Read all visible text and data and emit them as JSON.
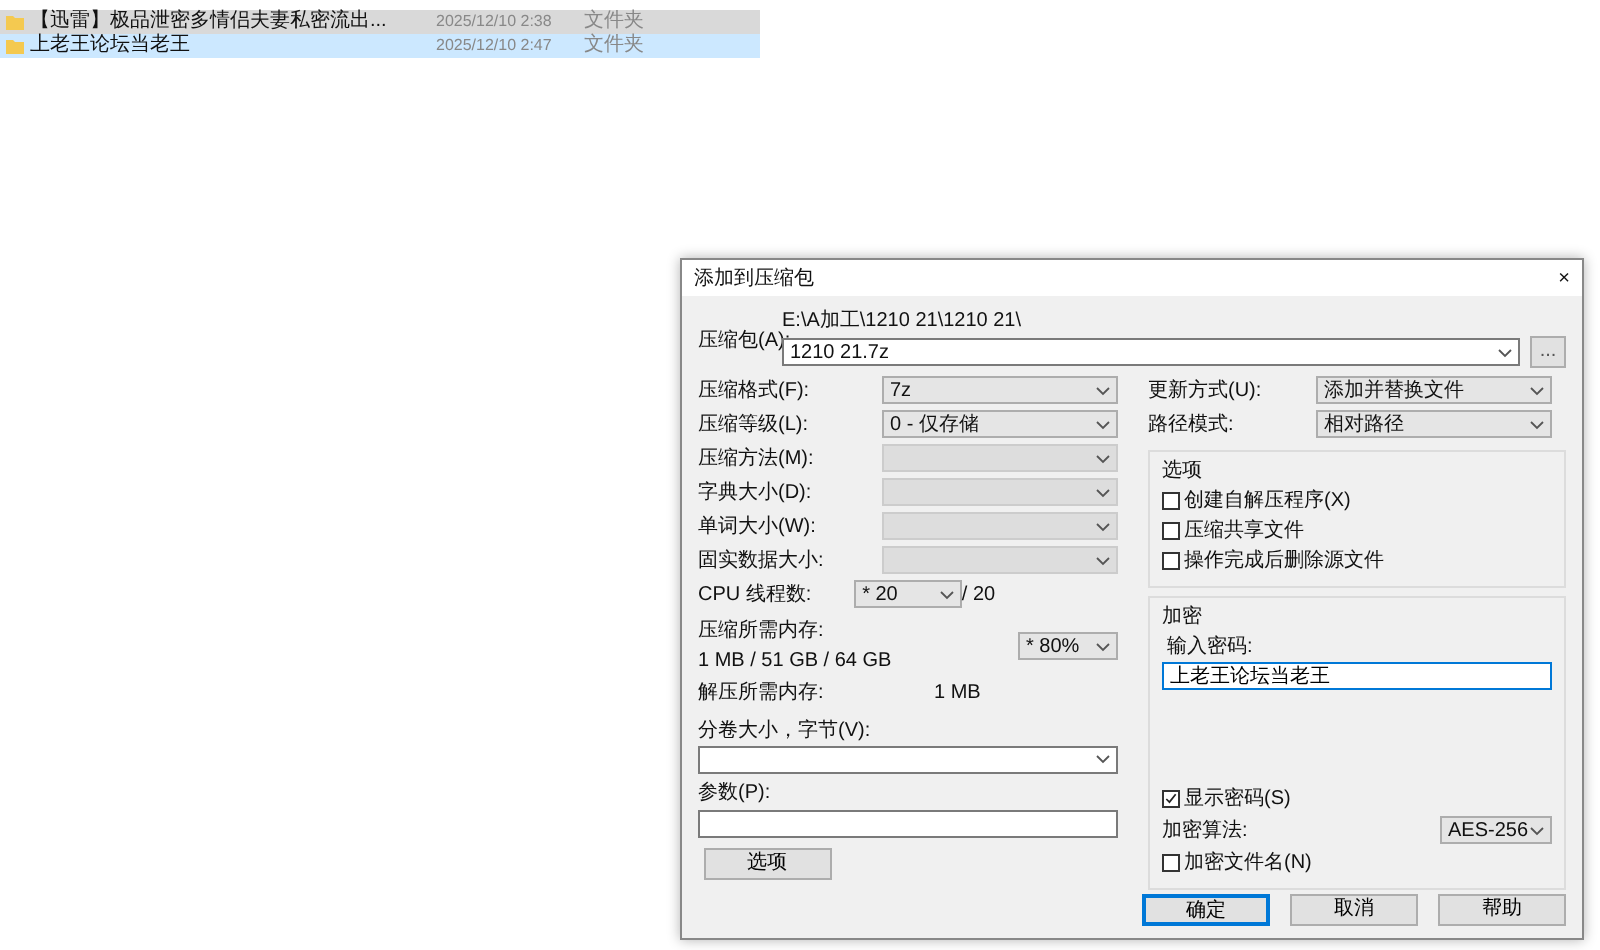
{
  "file_list": {
    "rows": [
      {
        "name": "【迅雷】极品泄密多情侣夫妻私密流出...",
        "date": "2025/12/10 2:38",
        "type": "文件夹",
        "selected": false,
        "hovered": true
      },
      {
        "name": "上老王论坛当老王",
        "date": "2025/12/10 2:47",
        "type": "文件夹",
        "selected": true,
        "hovered": false
      }
    ]
  },
  "dialog": {
    "title": "添加到压缩包",
    "close": "×",
    "archive": {
      "label": "压缩包(A):",
      "path": "E:\\A加工\\1210 21\\1210 21\\",
      "value": "1210 21.7z",
      "browse": {
        "label": "...",
        "disabled": true
      }
    },
    "left": [
      {
        "kind": "select",
        "label": "压缩格式(F):",
        "value": "7z",
        "disabled": false
      },
      {
        "kind": "select",
        "label": "压缩等级(L):",
        "value": "0 - 仅存储",
        "disabled": false
      },
      {
        "kind": "select",
        "label": "压缩方法(M):",
        "disabled": true
      },
      {
        "kind": "select",
        "label": "字典大小(D):",
        "disabled": true
      },
      {
        "kind": "select",
        "label": "单词大小(W):",
        "disabled": true
      },
      {
        "kind": "select",
        "label": "固实数据大小:",
        "disabled": true
      },
      {
        "kind": "threads",
        "label": "CPU 线程数:",
        "value": "* 20",
        "suffix": "/ 20"
      },
      {
        "kind": "memory",
        "label": "压缩所需内存:",
        "detail": "1 MB / 51 GB / 64 GB",
        "value": "* 80%"
      },
      {
        "kind": "info",
        "label": "解压所需内存:",
        "value": "1 MB"
      },
      {
        "kind": "field",
        "label": "分卷大小，字节(V):",
        "dropdown": true
      },
      {
        "kind": "field",
        "label": "参数(P):",
        "dropdown": false
      },
      {
        "kind": "button",
        "label": "选项"
      }
    ],
    "right": {
      "selects": [
        {
          "label": "更新方式(U):",
          "value": "添加并替换文件"
        },
        {
          "label": "路径模式:",
          "value": "相对路径"
        }
      ],
      "options": {
        "title": "选项",
        "items": [
          {
            "label": "创建自解压程序(X)",
            "checked": false
          },
          {
            "label": "压缩共享文件",
            "checked": false
          },
          {
            "label": "操作完成后删除源文件",
            "checked": false
          }
        ]
      },
      "encryption": {
        "title": "加密",
        "password_label": "输入密码:",
        "password": "上老王论坛当老王",
        "show": {
          "label": "显示密码(S)",
          "checked": true
        },
        "method": {
          "label": "加密算法:",
          "value": "AES-256"
        },
        "encrypt_names": {
          "label": "加密文件名(N)",
          "checked": false
        }
      }
    },
    "buttons": [
      {
        "label": "确定",
        "default": true
      },
      {
        "label": "取消",
        "default": false
      },
      {
        "label": "帮助",
        "default": false
      }
    ]
  }
}
